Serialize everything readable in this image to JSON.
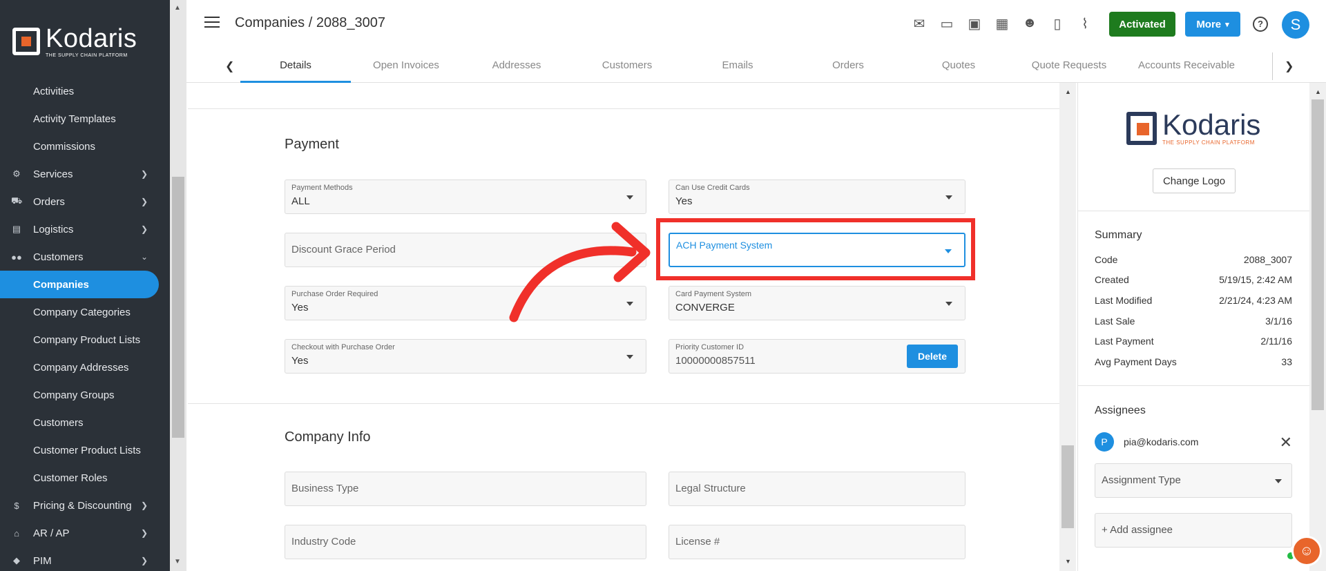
{
  "app": {
    "brand": "Kodaris",
    "brand_tagline": "THE SUPPLY CHAIN PLATFORM"
  },
  "sidebar": {
    "items": [
      {
        "label": "Activities",
        "type": "sub"
      },
      {
        "label": "Activity Templates",
        "type": "sub"
      },
      {
        "label": "Commissions",
        "type": "sub"
      },
      {
        "label": "Services",
        "type": "top",
        "icon": "gears-icon",
        "chevron": "right"
      },
      {
        "label": "Orders",
        "type": "top",
        "icon": "truck-icon",
        "chevron": "right"
      },
      {
        "label": "Logistics",
        "type": "top",
        "icon": "shipping-icon",
        "chevron": "right"
      },
      {
        "label": "Customers",
        "type": "top",
        "icon": "people-icon",
        "chevron": "down"
      },
      {
        "label": "Companies",
        "type": "sub",
        "active": true
      },
      {
        "label": "Company Categories",
        "type": "sub"
      },
      {
        "label": "Company Product Lists",
        "type": "sub"
      },
      {
        "label": "Company Addresses",
        "type": "sub"
      },
      {
        "label": "Company Groups",
        "type": "sub"
      },
      {
        "label": "Customers",
        "type": "sub"
      },
      {
        "label": "Customer Product Lists",
        "type": "sub"
      },
      {
        "label": "Customer Roles",
        "type": "sub"
      },
      {
        "label": "Pricing & Discounting",
        "type": "top",
        "icon": "dollar-icon",
        "chevron": "right"
      },
      {
        "label": "AR / AP",
        "type": "top",
        "icon": "bank-icon",
        "chevron": "right"
      },
      {
        "label": "PIM",
        "type": "top",
        "icon": "tag-icon",
        "chevron": "right"
      }
    ]
  },
  "header": {
    "breadcrumb": "Companies / 2088_3007",
    "status_label": "Activated",
    "more_label": "More",
    "avatar_initial": "S",
    "icons": [
      "mail-icon",
      "card-check-icon",
      "gift-icon",
      "building-icon",
      "person-add-icon",
      "note-add-icon",
      "attachment-icon"
    ]
  },
  "tabs": [
    "Details",
    "Open Invoices",
    "Addresses",
    "Customers",
    "Emails",
    "Orders",
    "Quotes",
    "Quote Requests",
    "Accounts Receivable"
  ],
  "payment": {
    "title": "Payment",
    "payment_methods": {
      "label": "Payment Methods",
      "value": "ALL"
    },
    "can_use_credit_cards": {
      "label": "Can Use Credit Cards",
      "value": "Yes"
    },
    "discount_grace_period": {
      "placeholder": "Discount Grace Period"
    },
    "ach_payment_system": {
      "placeholder": "ACH Payment System"
    },
    "purchase_order_required": {
      "label": "Purchase Order Required",
      "value": "Yes"
    },
    "card_payment_system": {
      "label": "Card Payment System",
      "value": "CONVERGE"
    },
    "checkout_with_po": {
      "label": "Checkout with Purchase Order",
      "value": "Yes"
    },
    "priority_customer_id": {
      "label": "Priority Customer ID",
      "value": "10000000857511",
      "delete_label": "Delete"
    }
  },
  "company_info": {
    "title": "Company Info",
    "business_type": "Business Type",
    "legal_structure": "Legal Structure",
    "industry_code": "Industry Code",
    "license": "License #"
  },
  "right_panel": {
    "change_logo": "Change Logo",
    "summary_title": "Summary",
    "summary": [
      {
        "label": "Code",
        "value": "2088_3007"
      },
      {
        "label": "Created",
        "value": "5/19/15, 2:42 AM"
      },
      {
        "label": "Last Modified",
        "value": "2/21/24, 4:23 AM"
      },
      {
        "label": "Last Sale",
        "value": "3/1/16"
      },
      {
        "label": "Last Payment",
        "value": "2/11/16"
      },
      {
        "label": "Avg Payment Days",
        "value": "33"
      }
    ],
    "assignees_title": "Assignees",
    "assignee": {
      "initial": "P",
      "email": "pia@kodaris.com"
    },
    "assignment_type": "Assignment Type",
    "add_assignee": "+ Add assignee"
  },
  "colors": {
    "accent": "#1e8fe0",
    "activated": "#1e7b1e",
    "highlight": "#f0302a",
    "sidebar": "#2b3138"
  }
}
